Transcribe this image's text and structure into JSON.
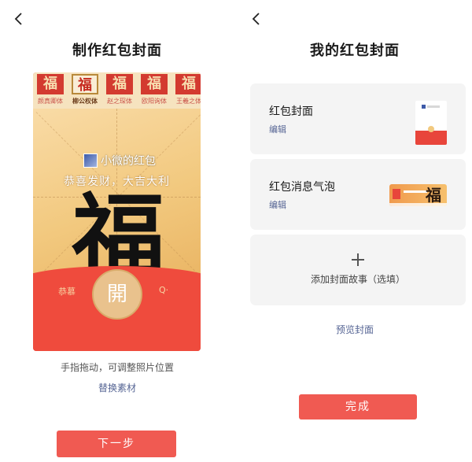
{
  "left": {
    "title": "制作红包封面",
    "font_options": [
      {
        "glyph": "福",
        "name": "颜真卿体"
      },
      {
        "glyph": "福",
        "name": "柳公权体"
      },
      {
        "glyph": "福",
        "name": "赵之琛体"
      },
      {
        "glyph": "福",
        "name": "欧阳询体"
      },
      {
        "glyph": "福",
        "name": "王羲之体"
      }
    ],
    "selected_font_index": 1,
    "packet": {
      "sender_name": "小微的红包",
      "greeting": "恭喜发财，大吉大利",
      "main_character": "福",
      "open_label": "開",
      "peek_left": "恭慕",
      "peek_right": "Q·"
    },
    "hint": "手指拖动，可调整照片位置",
    "replace_link": "替换素材",
    "next_button": "下一步"
  },
  "right": {
    "title": "我的红包封面",
    "cards": [
      {
        "title": "红包封面",
        "edit": "编辑",
        "thumb": "cover-thumbnail"
      },
      {
        "title": "红包消息气泡",
        "edit": "编辑",
        "thumb": "bubble-thumbnail",
        "thumb_char": "福"
      }
    ],
    "add_story": "添加封面故事（选填）",
    "preview_link": "预览封面",
    "done_button": "完成"
  },
  "colors": {
    "accent_red": "#f05a52",
    "link_blue": "#566594",
    "card_bg": "#f4f4f4",
    "paper_gold": "#f2c97f"
  },
  "icons": {
    "back": "chevron-left-icon",
    "add": "plus-icon"
  }
}
